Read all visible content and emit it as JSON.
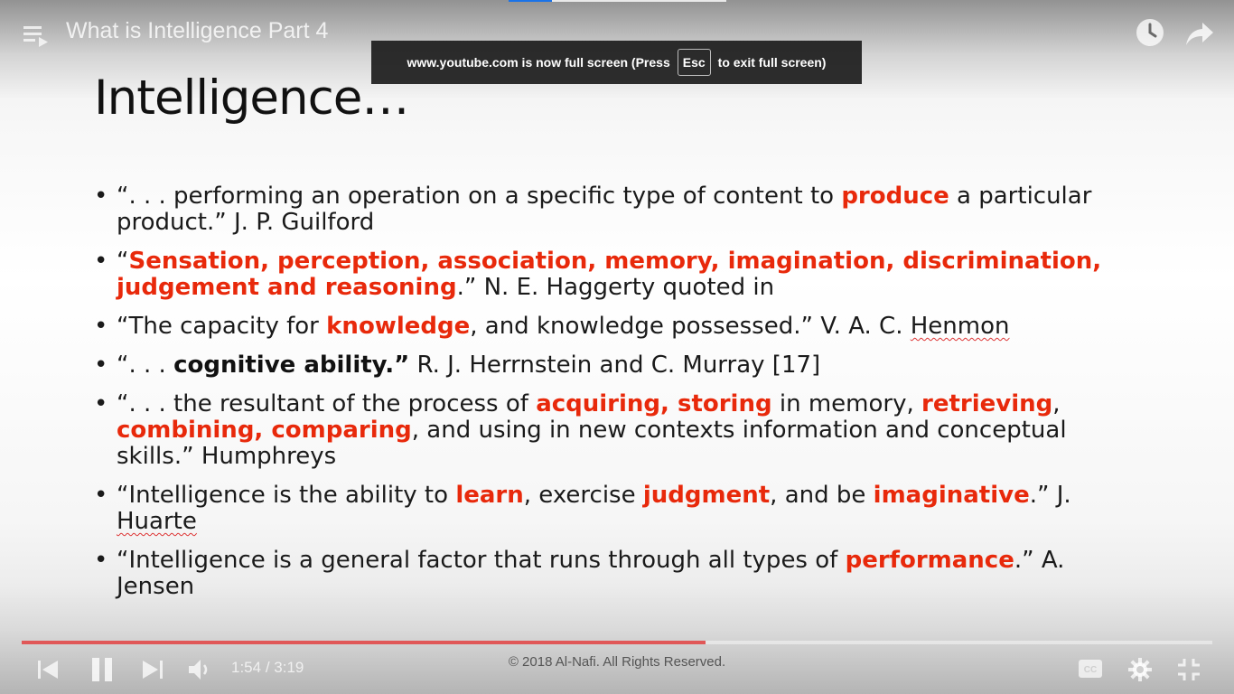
{
  "player": {
    "title": "What is Intelligence Part 4",
    "progress_fraction": 0.574,
    "time_current": "1:54",
    "time_separator": "/",
    "time_total": "3:19",
    "accent_color": "#e05757"
  },
  "fullscreen_notice": {
    "text_before": "www.youtube.com is now full screen (Press",
    "key": "Esc",
    "text_after": "to exit full screen)"
  },
  "slide": {
    "title": "Intelligence…",
    "bullet_glyph": "•",
    "highlight_color": "#e8290b",
    "bullets": [
      {
        "p1": "“. . . performing an operation on a specific type of content to ",
        "h1": "produce",
        "p2": " a particular product.” J. P. Guilford"
      },
      {
        "p1": "“",
        "h1": "Sensation, perception, association, memory, imagination, discrimination, judgement and reasoning",
        "p2": ".” N. E. Haggerty quoted in"
      },
      {
        "p1": "“The capacity for ",
        "h1": "knowledge",
        "p2": ", and knowledge possessed.” V. A. C. ",
        "u1": "Henmon"
      },
      {
        "p1": "“. . . ",
        "b1": "cognitive ability.”",
        "p2": " R. J. Herrnstein and C. Murray [17]"
      },
      {
        "p1": "“. . . the resultant of the process of ",
        "h1": "acquiring, storing",
        "p2": " in memory, ",
        "h2": "retrieving",
        "p3": ", ",
        "h3": "combining, comparing",
        "p4": ", and using in new contexts information and conceptual skills.” Humphreys"
      },
      {
        "p1": "“Intelligence is the ability to ",
        "h1": "learn",
        "p2": ", exercise ",
        "h2": "judgment",
        "p3": ", and be ",
        "h3": "imaginative",
        "p4": ".” J. ",
        "u1": "Huarte"
      },
      {
        "p1": "“Intelligence is a general factor that runs through all types of ",
        "h1": "performance",
        "p2": ".” A. Jensen"
      }
    ],
    "copyright": "© 2018 Al-Nafi. All Rights Reserved."
  },
  "icons": {
    "playlist": "playlist-icon",
    "watch_later": "clock-icon",
    "share": "share-icon",
    "previous": "skip-previous-icon",
    "pause": "pause-icon",
    "next": "skip-next-icon",
    "volume": "volume-icon",
    "captions": "captions-icon",
    "settings": "gear-icon",
    "exit_fullscreen": "exit-fullscreen-icon"
  }
}
